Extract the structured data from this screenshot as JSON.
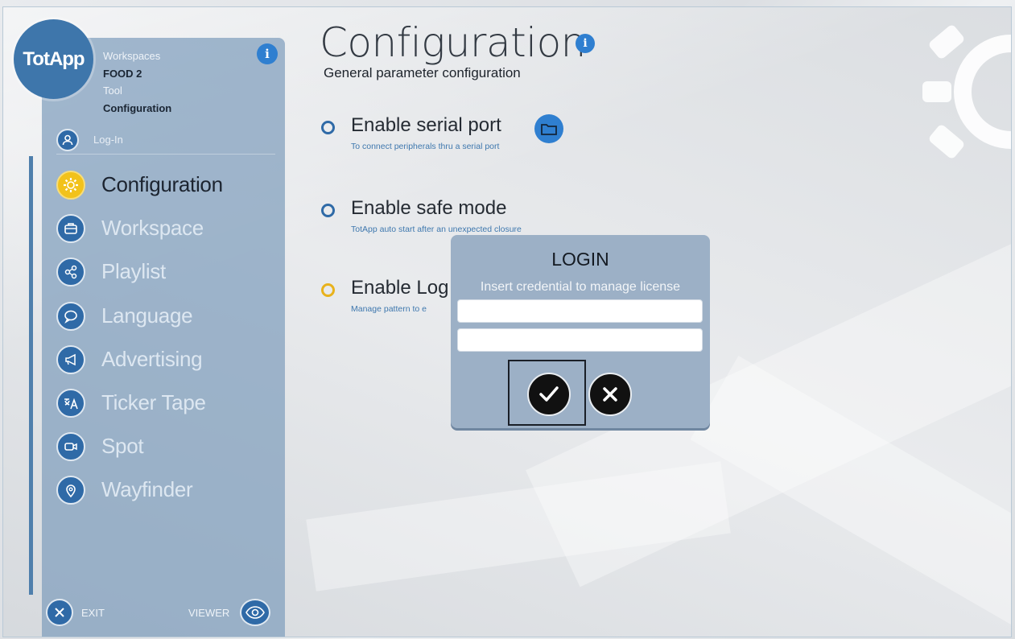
{
  "app": {
    "logo_text": "TotApp"
  },
  "sidebar": {
    "workspaces_label": "Workspaces",
    "workspace_name": "FOOD 2",
    "tool_label": "Tool",
    "tool_name": "Configuration",
    "login_label": "Log-In",
    "items": [
      {
        "label": "Configuration",
        "icon": "gear-icon",
        "active": true
      },
      {
        "label": "Workspace",
        "icon": "briefcase-icon",
        "active": false
      },
      {
        "label": "Playlist",
        "icon": "share-icon",
        "active": false
      },
      {
        "label": "Language",
        "icon": "speech-bubble-icon",
        "active": false
      },
      {
        "label": "Advertising",
        "icon": "megaphone-icon",
        "active": false
      },
      {
        "label": "Ticker Tape",
        "icon": "translate-icon",
        "active": false
      },
      {
        "label": "Spot",
        "icon": "video-camera-icon",
        "active": false
      },
      {
        "label": "Wayfinder",
        "icon": "map-pin-icon",
        "active": false
      }
    ],
    "exit_label": "EXIT",
    "viewer_label": "VIEWER"
  },
  "main": {
    "title": "Configuration",
    "subtitle": "General parameter configuration",
    "options": [
      {
        "title": "Enable serial port",
        "description": "To connect peripherals thru a serial port",
        "radio_color": "#2f6aa7"
      },
      {
        "title": "Enable safe mode",
        "description": "TotApp auto start after an unexpected closure",
        "radio_color": "#2f6aa7"
      },
      {
        "title": "Enable Log",
        "description": "Manage pattern to e",
        "radio_color": "#e8b21c"
      }
    ]
  },
  "login_dialog": {
    "title": "LOGIN",
    "subtitle": "Insert credential to manage license",
    "username_value": "",
    "password_value": ""
  },
  "colors": {
    "accent": "#2f7fd0",
    "active_nav": "#f2c21b",
    "sidebar": "#809ebc"
  }
}
